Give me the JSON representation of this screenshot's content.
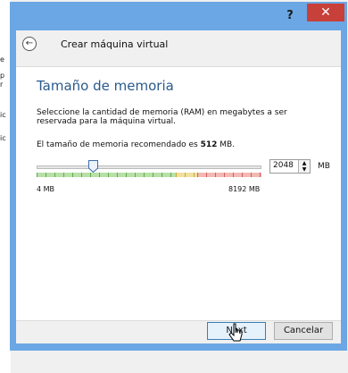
{
  "background": {
    "fragments": [
      "e",
      "p",
      "r",
      "ic",
      "ic"
    ]
  },
  "titlebar": {
    "help_label": "?",
    "close_label": "✕"
  },
  "header": {
    "title": "Crear máquina virtual"
  },
  "panel": {
    "title": "Tamaño de memoria",
    "description": "Seleccione la cantidad de memoria (RAM) en megabytes a ser reservada para la máquina virtual.",
    "recommend_prefix": "El tamaño de memoria recomendado es ",
    "recommend_value": "512",
    "recommend_suffix": " MB."
  },
  "memory_slider": {
    "min_label": "4 MB",
    "max_label": "8192 MB",
    "min_mb": 4,
    "max_mb": 8192,
    "value_mb": 2048
  },
  "memory_field": {
    "value": "2048",
    "unit": "MB"
  },
  "footer": {
    "next_label": "Next",
    "cancel_label": "Cancelar"
  },
  "colors": {
    "title_accent": "#2a5a8c",
    "window_frame": "#6ba7e5",
    "close_red": "#c7403a",
    "slider_green": "#b8e0a8",
    "slider_red": "#f3b9b4"
  }
}
